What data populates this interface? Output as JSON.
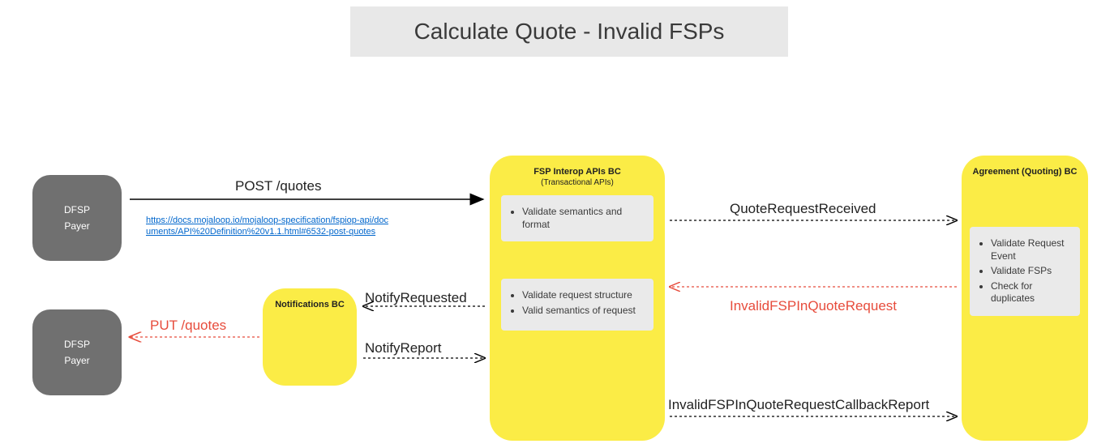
{
  "title": "Calculate Quote - Invalid FSPs",
  "nodes": {
    "dfsp_payer_1": {
      "line1": "DFSP",
      "line2": "Payer"
    },
    "dfsp_payer_2": {
      "line1": "DFSP",
      "line2": "Payer"
    },
    "notifications_bc": {
      "title": "Notifications BC"
    },
    "fsp_interop": {
      "title": "FSP Interop APIs BC",
      "subtitle": "(Transactional APIs)",
      "task1_items": [
        "Validate semantics and format"
      ],
      "task2_items": [
        "Validate request structure",
        "Valid semantics of request"
      ]
    },
    "agreement_bc": {
      "title": "Agreement (Quoting) BC",
      "task_items": [
        "Validate Request Event",
        "Validate FSPs",
        "Check for duplicates"
      ]
    }
  },
  "edges": {
    "post_quotes": "POST /quotes",
    "put_quotes": "PUT /quotes",
    "notify_requested": "NotifyRequested",
    "notify_report": "NotifyReport",
    "quote_request_received": "QuoteRequestReceived",
    "invalid_fsp_in_quote_request": "InvalidFSPInQuoteRequest",
    "invalid_fsp_callback_report": "InvalidFSPInQuoteRequestCallbackReport"
  },
  "link_url": "https://docs.mojaloop.io/mojaloop-specification/fspiop-api/documents/API%20Definition%20v1.1.html#6532-post-quotes",
  "colors": {
    "yellow": "#fbec46",
    "gray_node": "#707070",
    "gray_box": "#eaeaea",
    "red": "#e74c3c",
    "link_blue": "#0066cc"
  }
}
